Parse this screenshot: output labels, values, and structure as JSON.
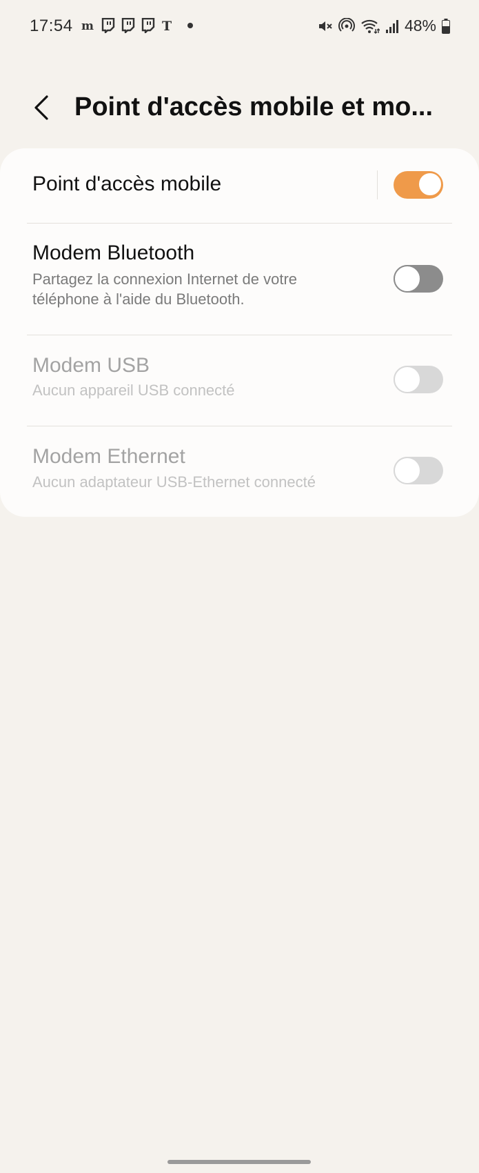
{
  "status_bar": {
    "time": "17:54",
    "notification_icons": [
      "monde-app-icon",
      "twitch-icon",
      "twitch-icon",
      "twitch-icon",
      "nytimes-icon"
    ],
    "system_icons": [
      "mute-icon",
      "hotspot-icon",
      "wifi-icon",
      "signal-icon"
    ],
    "battery_percent": "48%"
  },
  "header": {
    "title": "Point d'accès mobile et mo..."
  },
  "settings": [
    {
      "title": "Point d'accès mobile",
      "subtitle": "",
      "toggle_on": true,
      "enabled": true
    },
    {
      "title": "Modem Bluetooth",
      "subtitle": "Partagez la connexion Internet de votre téléphone à l'aide du Bluetooth.",
      "toggle_on": false,
      "enabled": true
    },
    {
      "title": "Modem USB",
      "subtitle": "Aucun appareil USB connecté",
      "toggle_on": false,
      "enabled": false
    },
    {
      "title": "Modem Ethernet",
      "subtitle": "Aucun adaptateur USB-Ethernet connecté",
      "toggle_on": false,
      "enabled": false
    }
  ],
  "colors": {
    "background": "#f5f2ed",
    "card": "#fdfcfb",
    "accent": "#ef9a4a"
  }
}
